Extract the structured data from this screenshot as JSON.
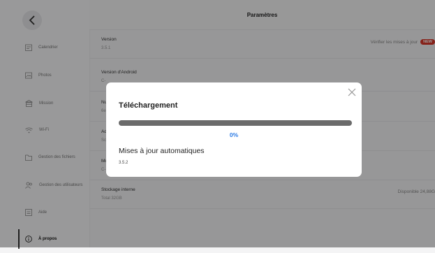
{
  "header": {
    "title": "Paramètres"
  },
  "sidebar": {
    "items": [
      {
        "label": "Calendrier",
        "icon": "calendar-icon"
      },
      {
        "label": "Photos",
        "icon": "photo-icon"
      },
      {
        "label": "Mission",
        "icon": "task-icon"
      },
      {
        "label": "Wi-Fi",
        "icon": "wifi-icon"
      },
      {
        "label": "Gestion des fichiers",
        "icon": "folder-icon"
      },
      {
        "label": "Gestion des utilisateurs",
        "icon": "users-icon"
      },
      {
        "label": "Aide",
        "icon": "help-icon"
      },
      {
        "label": "À propos",
        "icon": "info-icon"
      }
    ]
  },
  "rows": {
    "version": {
      "label": "Version",
      "value": "3.5.1",
      "action": "Vérifier les mises à jour",
      "badge": "NEW"
    },
    "android": {
      "label": "Version d'Android",
      "value": "C-"
    },
    "number": {
      "label": "Nu",
      "value": "6el"
    },
    "address": {
      "label": "Ad",
      "value": "Sc"
    },
    "model": {
      "label": "Mc",
      "value": "C-"
    },
    "storage": {
      "label": "Stockage interne",
      "value": "Total 32GB",
      "right": "Disponible 24,88G"
    }
  },
  "dialog": {
    "title": "Téléchargement",
    "progress_text": "0%",
    "progress_value": 0,
    "auto_title": "Mises à jour automatiques",
    "auto_version": "3.5.2"
  },
  "colors": {
    "accent": "#2c7be5",
    "badge": "#d9382b"
  }
}
